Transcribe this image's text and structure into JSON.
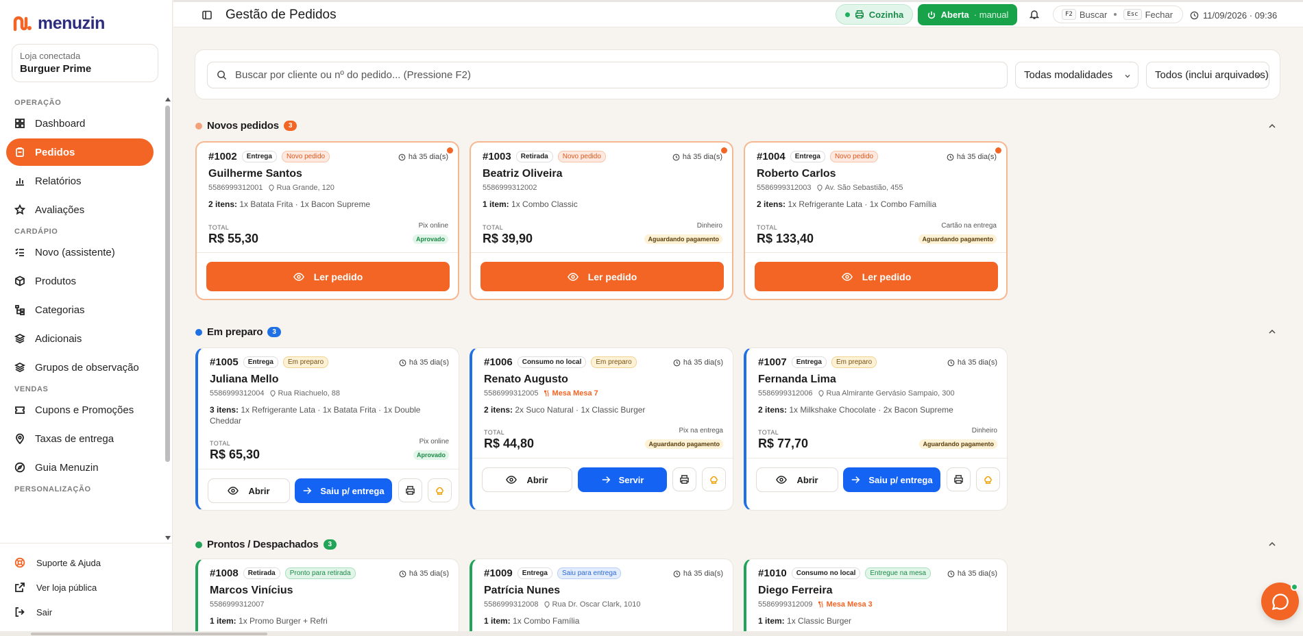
{
  "brand": {
    "name": "menuzin",
    "accent": "#f26524"
  },
  "store": {
    "label": "Loja conectada",
    "name": "Burguer Prime"
  },
  "nav": {
    "sections": [
      {
        "title": "OPERAÇÃO",
        "items": [
          {
            "label": "Dashboard",
            "icon": "grid-icon"
          },
          {
            "label": "Pedidos",
            "icon": "clipboard-icon",
            "active": true
          },
          {
            "label": "Relatórios",
            "icon": "bar-chart-icon"
          },
          {
            "label": "Avaliações",
            "icon": "star-icon"
          }
        ]
      },
      {
        "title": "CARDÁPIO",
        "items": [
          {
            "label": "Novo (assistente)",
            "icon": "list-check-icon"
          },
          {
            "label": "Produtos",
            "icon": "box-icon"
          },
          {
            "label": "Categorias",
            "icon": "tree-icon"
          },
          {
            "label": "Adicionais",
            "icon": "layers-icon"
          },
          {
            "label": "Grupos de observação",
            "icon": "stack-icon"
          }
        ]
      },
      {
        "title": "VENDAS",
        "items": [
          {
            "label": "Cupons e Promoções",
            "icon": "ticket-icon"
          },
          {
            "label": "Taxas de entrega",
            "icon": "pin-icon"
          },
          {
            "label": "Guia Menuzin",
            "icon": "compass-icon"
          }
        ]
      },
      {
        "title": "PERSONALIZAÇÃO",
        "items": []
      }
    ],
    "bottom": [
      {
        "label": "Suporte & Ajuda",
        "icon": "lifebuoy-icon"
      },
      {
        "label": "Ver loja pública",
        "icon": "external-link-icon"
      },
      {
        "label": "Sair",
        "icon": "logout-icon"
      }
    ]
  },
  "topbar": {
    "title": "Gestão de Pedidos",
    "kitchen_label": "Cozinha",
    "open_label": "Aberta",
    "open_mode": "· manual",
    "shortcut_search_key": "F2",
    "shortcut_search_label": "Buscar",
    "shortcut_close_key": "Esc",
    "shortcut_close_label": "Fechar",
    "datetime": "11/09/2026 · 09:36"
  },
  "filters": {
    "search_placeholder": "Buscar por cliente ou nº do pedido... (Pressione F2)",
    "modality": "Todas modalidades",
    "archive": "Todos (inclui arquivados)"
  },
  "sections": {
    "new": {
      "title": "Novos pedidos",
      "count": "3",
      "color": "#f4a07a"
    },
    "prep": {
      "title": "Em preparo",
      "count": "3",
      "color": "#1f6fe5"
    },
    "ready": {
      "title": "Prontos / Despachados",
      "count": "3",
      "color": "#22a458"
    }
  },
  "orders": {
    "o1002": {
      "id": "#1002",
      "type": "Entrega",
      "status": "Novo pedido",
      "time": "há 35 dia(s)",
      "customer": "Guilherme Santos",
      "phone": "5586999312001",
      "address": "Rua Grande, 120",
      "items_count": "2 itens:",
      "items": " 1x Batata Frita · 1x Bacon Supreme",
      "total_label": "TOTAL",
      "total": "R$ 55,30",
      "pay_method": "Pix online",
      "pay_status": "Aprovado",
      "action": "Ler pedido"
    },
    "o1003": {
      "id": "#1003",
      "type": "Retirada",
      "status": "Novo pedido",
      "time": "há 35 dia(s)",
      "customer": "Beatriz Oliveira",
      "phone": "5586999312002",
      "items_count": "1 item:",
      "items": " 1x Combo Classic",
      "total_label": "TOTAL",
      "total": "R$ 39,90",
      "pay_method": "Dinheiro",
      "pay_status": "Aguardando pagamento",
      "action": "Ler pedido"
    },
    "o1004": {
      "id": "#1004",
      "type": "Entrega",
      "status": "Novo pedido",
      "time": "há 35 dia(s)",
      "customer": "Roberto Carlos",
      "phone": "5586999312003",
      "address": "Av. São Sebastião, 455",
      "items_count": "2 itens:",
      "items": " 1x Refrigerante Lata · 1x Combo Família",
      "total_label": "TOTAL",
      "total": "R$ 133,40",
      "pay_method": "Cartão na entrega",
      "pay_status": "Aguardando pagamento",
      "action": "Ler pedido"
    },
    "o1005": {
      "id": "#1005",
      "type": "Entrega",
      "status": "Em preparo",
      "time": "há 35 dia(s)",
      "customer": "Juliana Mello",
      "phone": "5586999312004",
      "address": "Rua Riachuelo, 88",
      "items_count": "3 itens:",
      "items": " 1x Refrigerante Lata · 1x Batata Frita · 1x Double Cheddar",
      "total_label": "TOTAL",
      "total": "R$ 65,30",
      "pay_method": "Pix online",
      "pay_status": "Aprovado",
      "open": "Abrir",
      "action": "Saiu p/ entrega"
    },
    "o1006": {
      "id": "#1006",
      "type": "Consumo no local",
      "status": "Em preparo",
      "time": "há 35 dia(s)",
      "customer": "Renato Augusto",
      "phone": "5586999312005",
      "table": "Mesa Mesa 7",
      "items_count": "2 itens:",
      "items": " 2x Suco Natural · 1x Classic Burger",
      "total_label": "TOTAL",
      "total": "R$ 44,80",
      "pay_method": "Pix na entrega",
      "pay_status": "Aguardando pagamento",
      "open": "Abrir",
      "action": "Servir"
    },
    "o1007": {
      "id": "#1007",
      "type": "Entrega",
      "status": "Em preparo",
      "time": "há 35 dia(s)",
      "customer": "Fernanda Lima",
      "phone": "5586999312006",
      "address": "Rua Almirante Gervásio Sampaio, 300",
      "items_count": "2 itens:",
      "items": " 1x Milkshake Chocolate · 2x Bacon Supreme",
      "total_label": "TOTAL",
      "total": "R$ 77,70",
      "pay_method": "Dinheiro",
      "pay_status": "Aguardando pagamento",
      "open": "Abrir",
      "action": "Saiu p/ entrega"
    },
    "o1008": {
      "id": "#1008",
      "type": "Retirada",
      "status": "Pronto para retirada",
      "time": "há 35 dia(s)",
      "customer": "Marcos Vinícius",
      "phone": "5586999312007",
      "items_count": "1 item:",
      "items": " 1x Promo Burger + Refri"
    },
    "o1009": {
      "id": "#1009",
      "type": "Entrega",
      "status": "Saiu para entrega",
      "time": "há 35 dia(s)",
      "customer": "Patrícia Nunes",
      "phone": "5586999312008",
      "address": "Rua Dr. Oscar Clark, 1010",
      "items_count": "1 item:",
      "items": " 1x Combo Família"
    },
    "o1010": {
      "id": "#1010",
      "type": "Consumo no local",
      "status": "Entregue na mesa",
      "time": "há 35 dia(s)",
      "customer": "Diego Ferreira",
      "phone": "5586999312009",
      "table": "Mesa Mesa 3",
      "items_count": "1 item:",
      "items": " 1x Classic Burger"
    }
  }
}
